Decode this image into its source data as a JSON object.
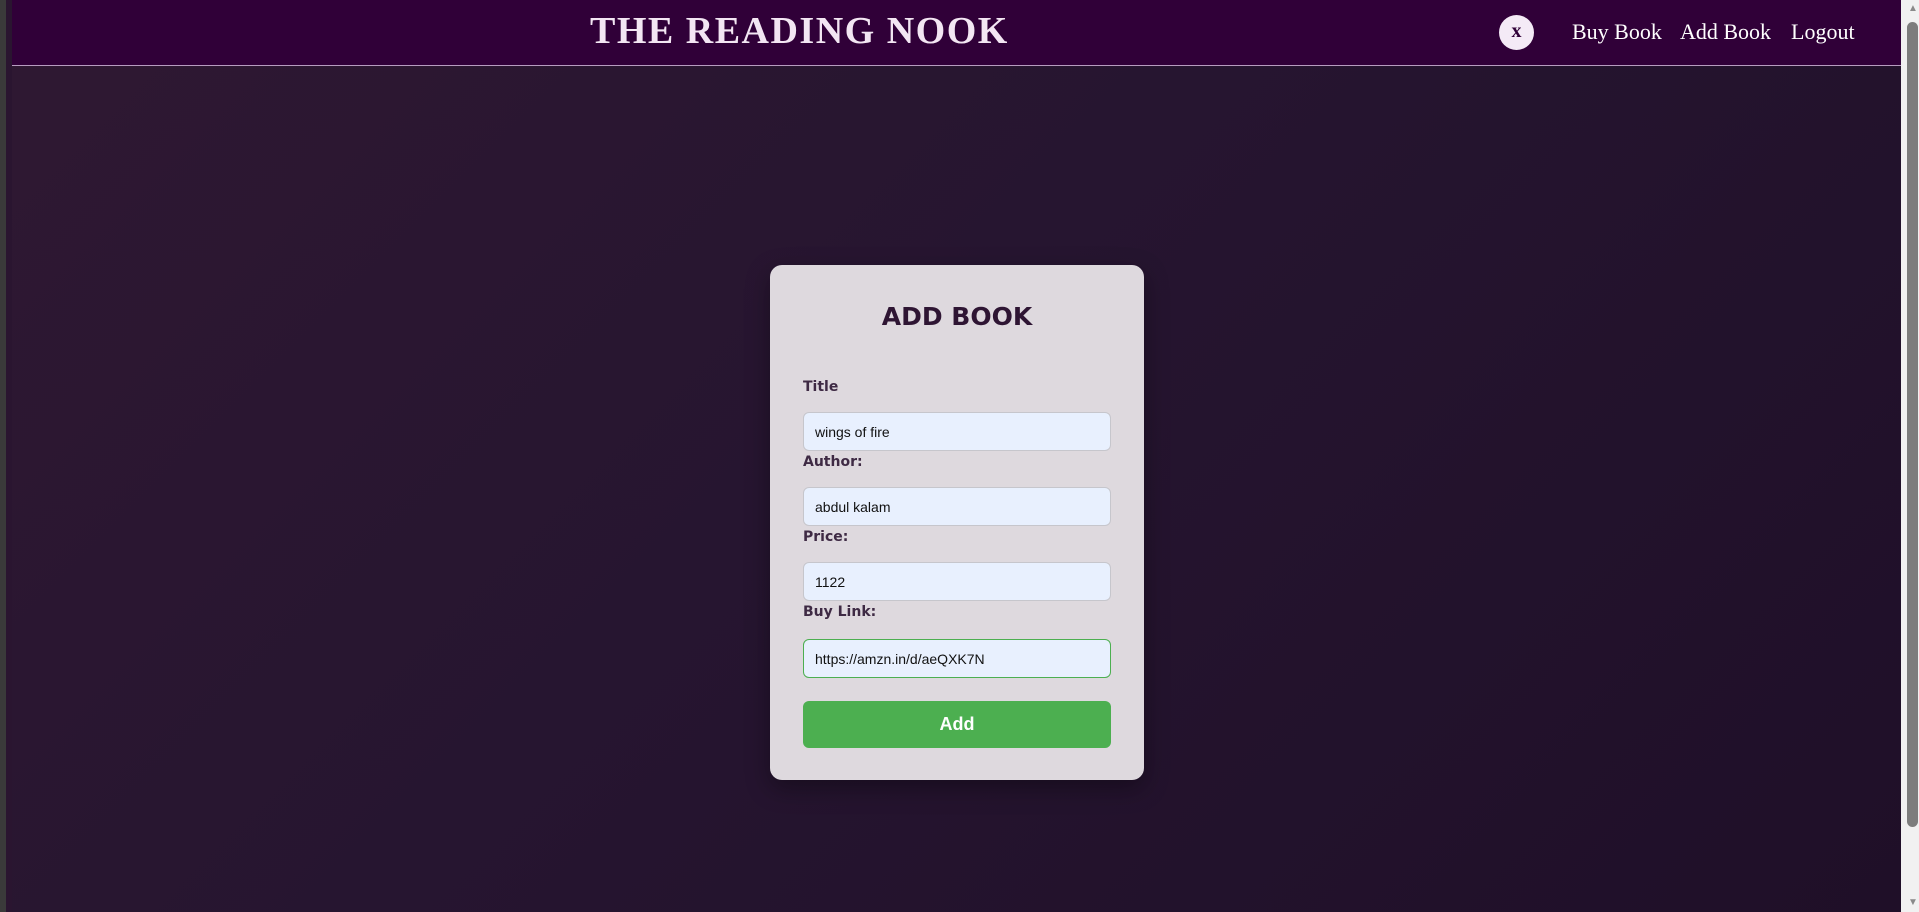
{
  "navbar": {
    "site_title": "THE READING NOOK",
    "close_label": "x",
    "links": [
      "Buy Book",
      "Add Book",
      "Logout"
    ]
  },
  "form": {
    "heading": "ADD BOOK",
    "fields": [
      {
        "label": "Title",
        "value": "wings of fire"
      },
      {
        "label": "Author:",
        "value": "abdul kalam"
      },
      {
        "label": "Price:",
        "value": "1122"
      },
      {
        "label": "Buy Link:",
        "value": "https://amzn.in/d/aeQXK7N"
      }
    ],
    "submit_label": "Add"
  },
  "colors": {
    "navbar_bg": "#300038",
    "page_bg": "#2a1530",
    "card_bg": "#ded9de",
    "button_bg": "#4caf50",
    "input_bg": "#e8f0fe"
  },
  "icons": {
    "scroll_up": "scroll-up-arrow-icon",
    "scroll_down": "scroll-down-arrow-icon"
  }
}
